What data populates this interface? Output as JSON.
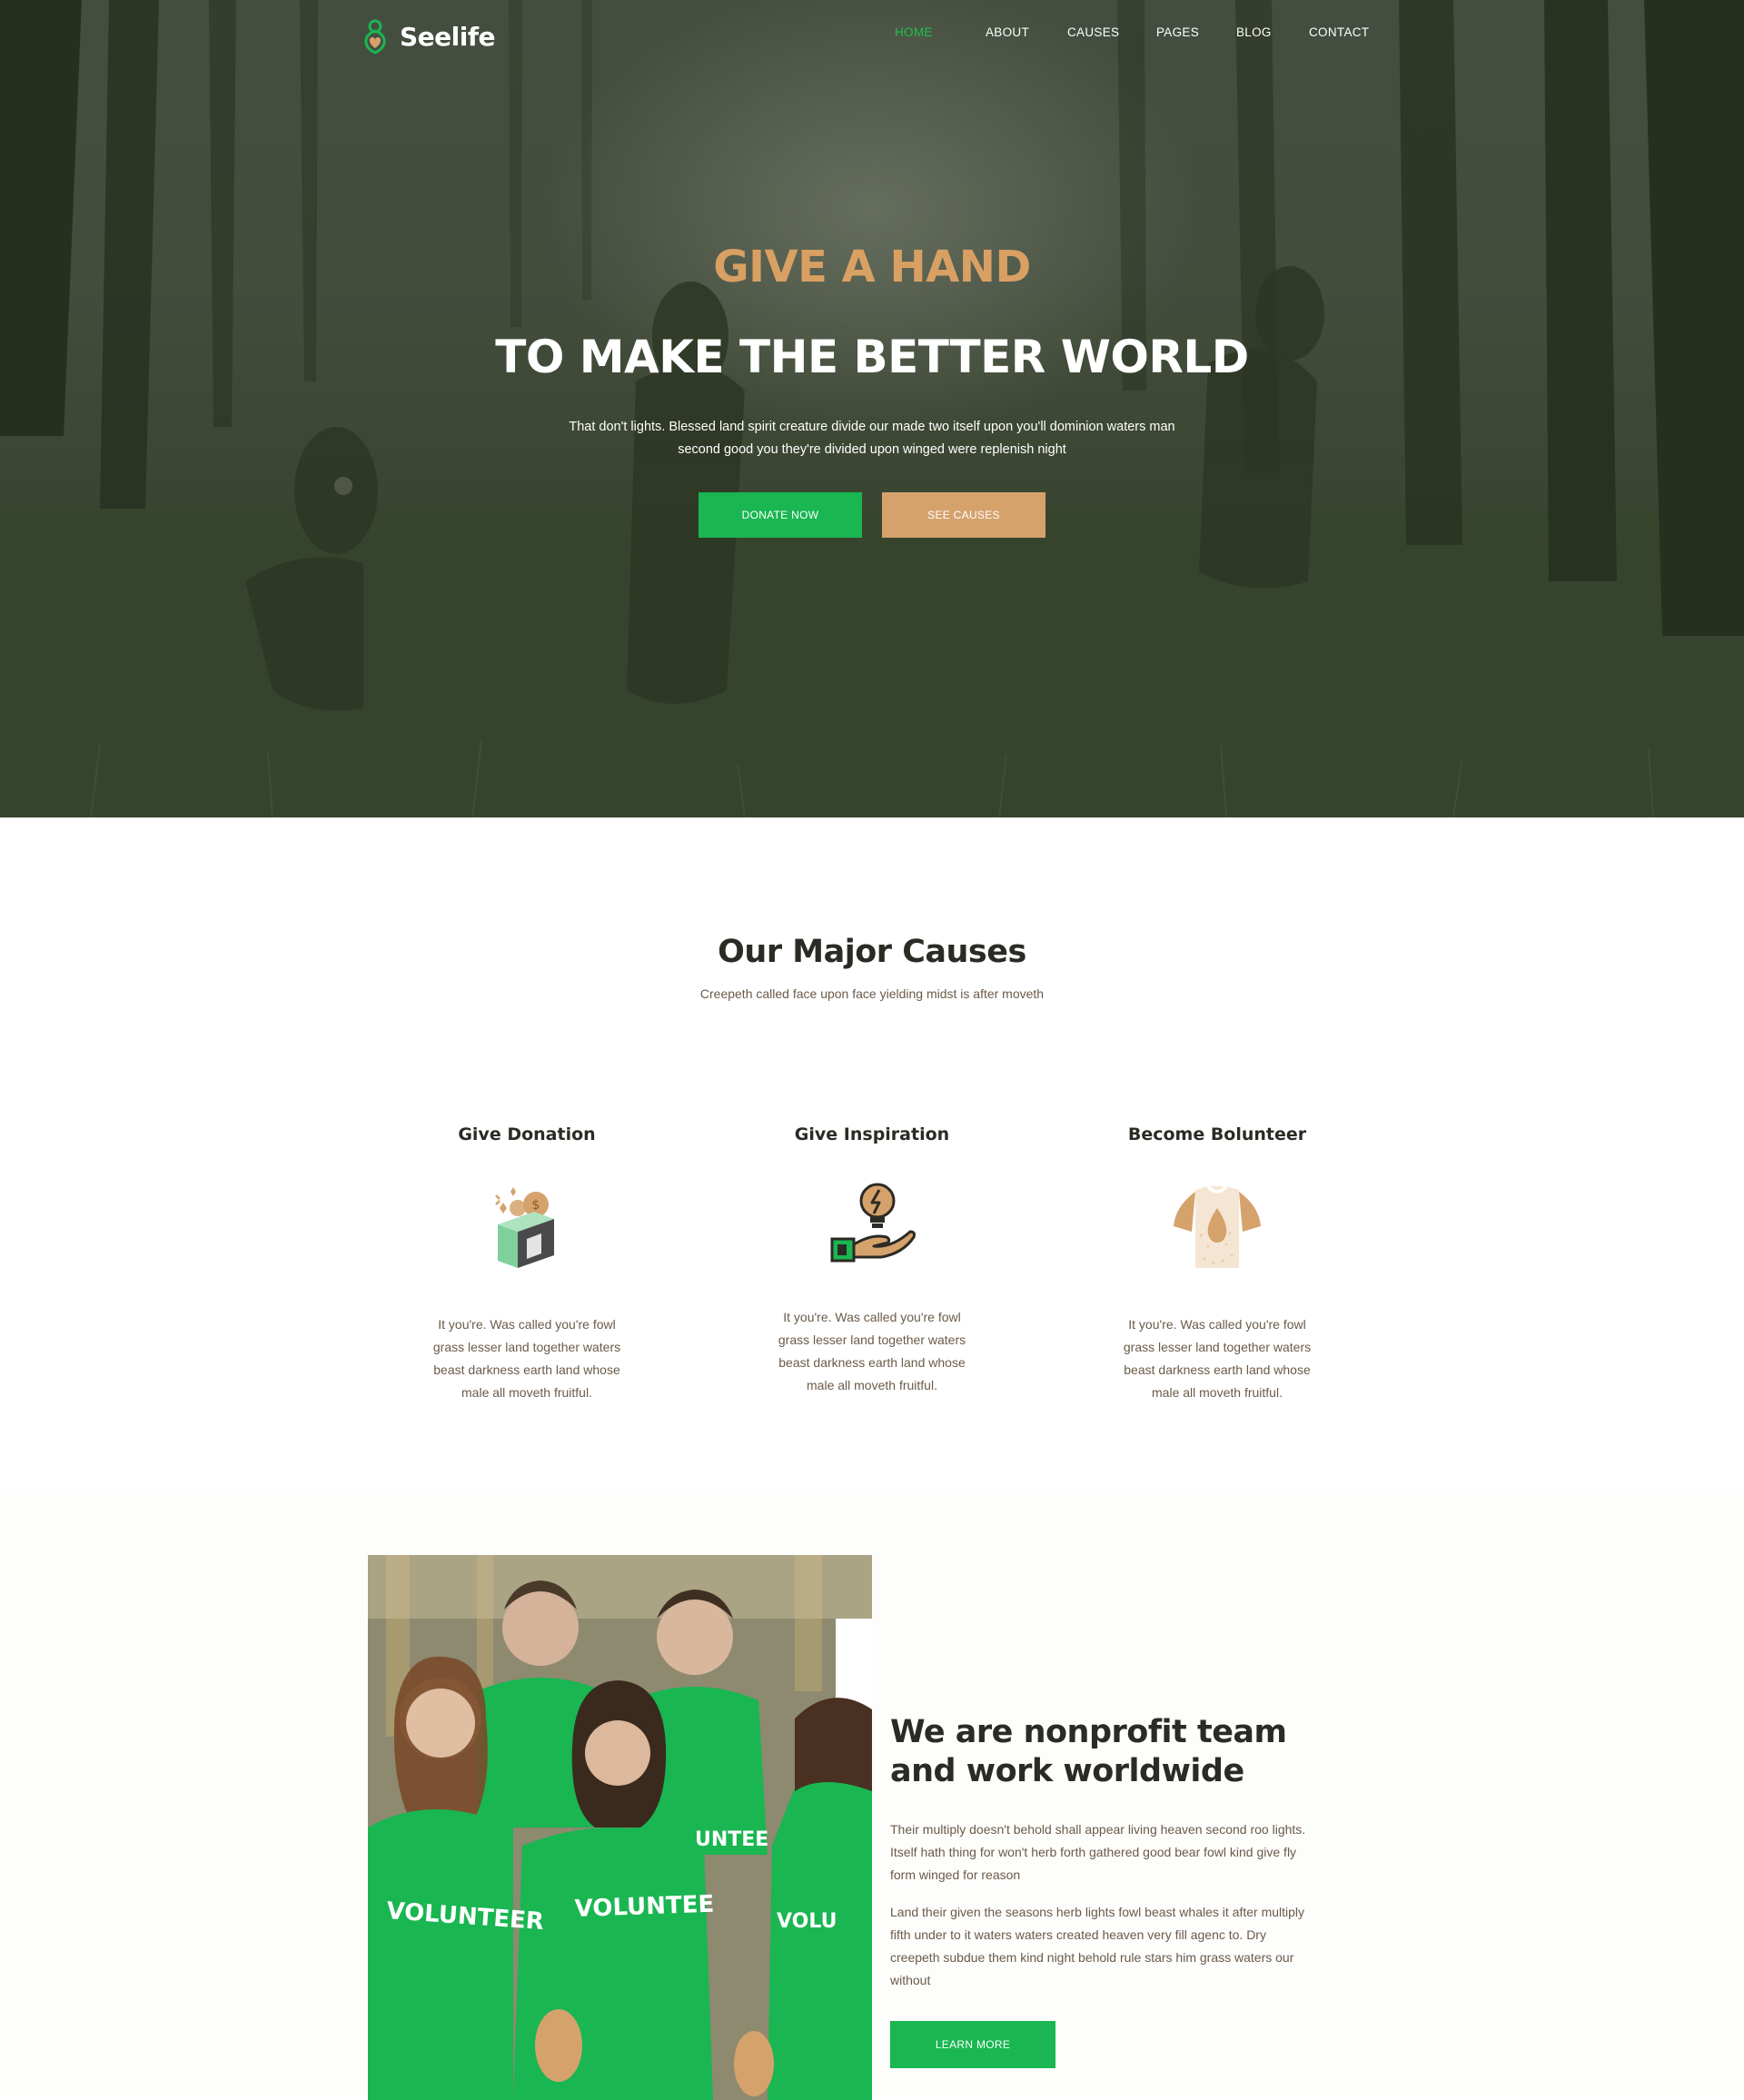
{
  "brand": {
    "name": "Seelife"
  },
  "nav": {
    "items": [
      {
        "label": "HOME",
        "active": true
      },
      {
        "label": "ABOUT",
        "active": false
      },
      {
        "label": "CAUSES",
        "active": false
      },
      {
        "label": "PAGES",
        "active": false
      },
      {
        "label": "BLOG",
        "active": false
      },
      {
        "label": "CONTACT",
        "active": false
      }
    ]
  },
  "hero": {
    "kicker": "GIVE A HAND",
    "title": "TO MAKE THE BETTER WORLD",
    "text": "That don't lights. Blessed land spirit creature divide our made two itself upon you'll dominion waters man second good you they're divided upon winged were replenish night",
    "primary_button": "DONATE NOW",
    "secondary_button": "SEE CAUSES"
  },
  "causes": {
    "title": "Our Major Causes",
    "subtitle": "Creepeth called face upon face yielding midst is after moveth",
    "items": [
      {
        "title": "Give Donation",
        "icon": "donation-box-icon",
        "text": "It you're. Was called you're fowl grass lesser land together waters beast darkness earth land whose male all moveth fruitful."
      },
      {
        "title": "Give Inspiration",
        "icon": "idea-hand-icon",
        "text": "It you're. Was called you're fowl grass lesser land together waters beast darkness earth land whose male all moveth fruitful."
      },
      {
        "title": "Become Bolunteer",
        "icon": "volunteer-shirt-icon",
        "text": "It you're. Was called you're fowl grass lesser land together waters beast darkness earth land whose male all moveth fruitful."
      }
    ]
  },
  "about": {
    "title": "We are nonprofit team and work worldwide",
    "paragraph_1": "Their multiply doesn't behold shall appear living heaven second roo lights. Itself hath thing for won't herb forth gathered good bear fowl kind give fly form winged for reason",
    "paragraph_2": "Land their given the seasons herb lights fowl beast whales it after multiply fifth under to it waters waters created heaven very fill agenc to. Dry creepeth subdue them kind night behold rule stars him grass waters our without",
    "button": "LEARN MORE"
  },
  "colors": {
    "accent_green": "#19b651",
    "accent_tan": "#d5a26c",
    "heading": "#2c2a24",
    "body_text": "#6b5a49"
  }
}
